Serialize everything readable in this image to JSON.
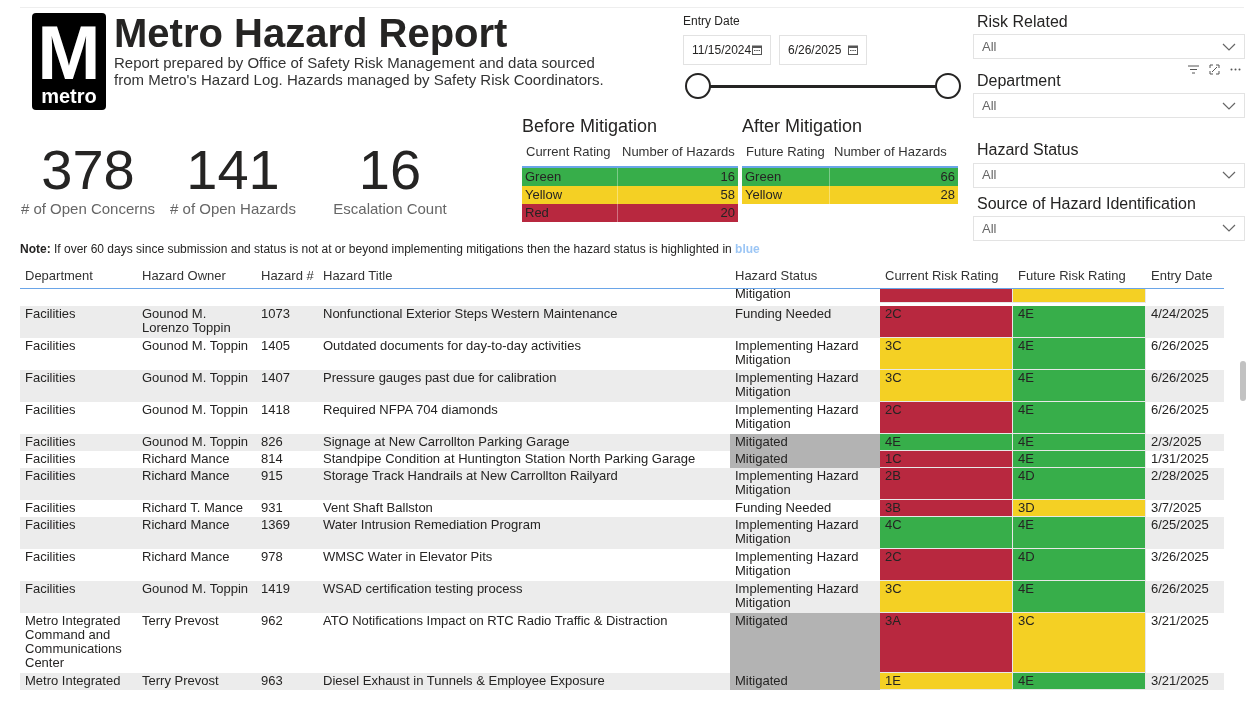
{
  "header": {
    "title": "Metro Hazard Report",
    "subtitle": "Report prepared by Office of Safety Risk Management and data sourced from Metro's Hazard Log. Hazards managed by Safety Risk Coordinators.",
    "logo_text": "metro",
    "logo_letter": "M"
  },
  "date_filter": {
    "label": "Entry Date",
    "start": "11/15/2024",
    "end": "6/26/2025",
    "handles": [
      {
        "level": 0
      },
      {
        "level": 1
      }
    ]
  },
  "kpis": [
    {
      "value": "378",
      "label": "# of Open Concerns"
    },
    {
      "value": "141",
      "label": "# of Open Hazards"
    },
    {
      "value": "16",
      "label": "Escalation Count"
    }
  ],
  "mitigation_tables": [
    {
      "title": "Before Mitigation",
      "columns": [
        "Current Rating",
        "Number of Hazards"
      ],
      "rows": [
        {
          "rating": "Green",
          "count": "16",
          "color": "#37ae4a"
        },
        {
          "rating": "Yellow",
          "count": "58",
          "color": "#f4d024"
        },
        {
          "rating": "Red",
          "count": "20",
          "color": "#b8283f"
        }
      ]
    },
    {
      "title": "After Mitigation",
      "columns": [
        "Future Rating",
        "Number of Hazards"
      ],
      "rows": [
        {
          "rating": "Green",
          "count": "66",
          "color": "#37ae4a"
        },
        {
          "rating": "Yellow",
          "count": "28",
          "color": "#f4d024"
        }
      ]
    }
  ],
  "note": "**Note:** If over 60 days since submission and status is not at or beyond implementing mitigations then the hazard status is highlighted in **blue**",
  "slicers": [
    {
      "label": "Risk Related",
      "value": "All"
    },
    {
      "label": "Department",
      "value": "All"
    },
    {
      "label": "Hazard Status",
      "value": "All"
    },
    {
      "label": "Source of Hazard Identification",
      "value": "All"
    }
  ],
  "table": {
    "columns": [
      "Department",
      "Hazard Owner",
      "Hazard #",
      "Hazard Title",
      "Hazard Status",
      "Current Risk Rating",
      "Future Risk Rating",
      "Entry Date"
    ],
    "rows": [
      {
        "department": "",
        "owner": "",
        "number": "",
        "title": "",
        "status": "Mitigation",
        "shaded": false,
        "current": {
          "color": "#b8283f"
        },
        "future": {
          "color": "#f4d024"
        },
        "date": ""
      },
      {
        "department": "Facilities",
        "owner": "Gounod M. Lorenzo Toppin",
        "number": "1073",
        "title": "Nonfunctional Exterior Steps Western Maintenance",
        "status": "Funding Needed",
        "shaded": false,
        "current": {
          "text": "2C",
          "color": "#b8283f"
        },
        "future": {
          "text": "4E",
          "color": "#37ae4a"
        },
        "date": "4/24/2025"
      },
      {
        "department": "Facilities",
        "owner": "Gounod M. Toppin",
        "number": "1405",
        "title": "Outdated documents for day-to-day activities",
        "status": "Implementing Hazard Mitigation",
        "shaded": false,
        "current": {
          "text": "3C",
          "color": "#f4d024"
        },
        "future": {
          "text": "4E",
          "color": "#37ae4a"
        },
        "date": "6/26/2025"
      },
      {
        "department": "Facilities",
        "owner": "Gounod M. Toppin",
        "number": "1407",
        "title": "Pressure gauges past due for calibration",
        "status": "Implementing Hazard Mitigation",
        "shaded": false,
        "current": {
          "text": "3C",
          "color": "#f4d024"
        },
        "future": {
          "text": "4E",
          "color": "#37ae4a"
        },
        "date": "6/26/2025"
      },
      {
        "department": "Facilities",
        "owner": "Gounod M. Toppin",
        "number": "1418",
        "title": "Required NFPA 704 diamonds",
        "status": "Implementing Hazard Mitigation",
        "shaded": false,
        "current": {
          "text": "2C",
          "color": "#b8283f"
        },
        "future": {
          "text": "4E",
          "color": "#37ae4a"
        },
        "date": "6/26/2025"
      },
      {
        "department": "Facilities",
        "owner": "Gounod M. Toppin",
        "number": "826",
        "title": "Signage at New Carrollton Parking Garage",
        "status": "Mitigated",
        "shaded": true,
        "current": {
          "text": "4E",
          "color": "#37ae4a"
        },
        "future": {
          "text": "4E",
          "color": "#37ae4a"
        },
        "date": "2/3/2025"
      },
      {
        "department": "Facilities",
        "owner": "Richard Mance",
        "number": "814",
        "title": "Standpipe Condition at Huntington Station North Parking Garage",
        "status": "Mitigated",
        "shaded": true,
        "current": {
          "text": "1C",
          "color": "#b8283f"
        },
        "future": {
          "text": "4E",
          "color": "#37ae4a"
        },
        "date": "1/31/2025"
      },
      {
        "department": "Facilities",
        "owner": "Richard Mance",
        "number": "915",
        "title": "Storage Track Handrails at New Carrollton Railyard",
        "status": "Implementing Hazard Mitigation",
        "shaded": false,
        "current": {
          "text": "2B",
          "color": "#b8283f"
        },
        "future": {
          "text": "4D",
          "color": "#37ae4a"
        },
        "date": "2/28/2025"
      },
      {
        "department": "Facilities",
        "owner": "Richard T. Mance",
        "number": "931",
        "title": "Vent Shaft Ballston",
        "status": "Funding Needed",
        "shaded": false,
        "current": {
          "text": "3B",
          "color": "#b8283f"
        },
        "future": {
          "text": "3D",
          "color": "#f4d024"
        },
        "date": "3/7/2025"
      },
      {
        "department": "Facilities",
        "owner": "Richard Mance",
        "number": "1369",
        "title": "Water Intrusion Remediation Program",
        "status": "Implementing Hazard Mitigation",
        "shaded": false,
        "current": {
          "text": "4C",
          "color": "#37ae4a"
        },
        "future": {
          "text": "4E",
          "color": "#37ae4a"
        },
        "date": "6/25/2025"
      },
      {
        "department": "Facilities",
        "owner": "Richard Mance",
        "number": "978",
        "title": "WMSC Water in Elevator Pits",
        "status": "Implementing Hazard Mitigation",
        "shaded": false,
        "current": {
          "text": "2C",
          "color": "#b8283f"
        },
        "future": {
          "text": "4D",
          "color": "#37ae4a"
        },
        "date": "3/26/2025"
      },
      {
        "department": "Facilities",
        "owner": "Gounod M. Toppin",
        "number": "1419",
        "title": "WSAD certification testing process",
        "status": "Implementing Hazard Mitigation",
        "shaded": false,
        "current": {
          "text": "3C",
          "color": "#f4d024"
        },
        "future": {
          "text": "4E",
          "color": "#37ae4a"
        },
        "date": "6/26/2025"
      },
      {
        "department": "Metro Integrated Command and Communications Center",
        "owner": "Terry Prevost",
        "number": "962",
        "title": "ATO Notifications Impact on RTC Radio Traffic & Distraction",
        "status": "Mitigated",
        "shaded": true,
        "current": {
          "text": "3A",
          "color": "#b8283f"
        },
        "future": {
          "text": "3C",
          "color": "#f4d024"
        },
        "date": "3/21/2025"
      },
      {
        "department": "Metro Integrated",
        "owner": "Terry Prevost",
        "number": "963",
        "title": "Diesel Exhaust in Tunnels & Employee Exposure",
        "status": "Mitigated",
        "shaded": true,
        "current": {
          "text": "1E",
          "color": "#f4d024"
        },
        "future": {
          "text": "4E",
          "color": "#37ae4a"
        },
        "date": "3/21/2025"
      }
    ]
  }
}
